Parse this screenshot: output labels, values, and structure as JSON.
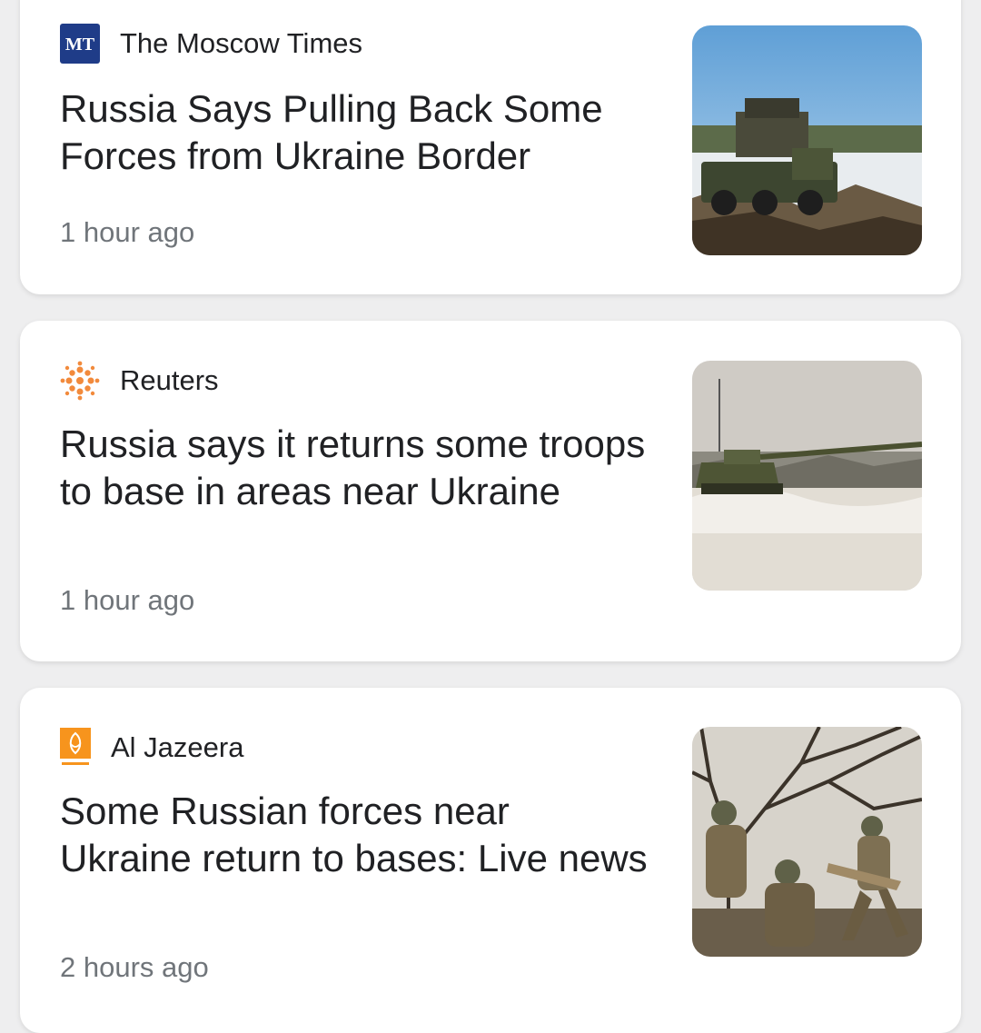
{
  "articles": [
    {
      "source": "The Moscow Times",
      "logo_text": "MT",
      "logo_icon": "moscow-times-logo",
      "headline": "Russia Says Pulling Back Some Forces from Ukraine Border",
      "time": "1 hour ago",
      "thumbnail": "military-vehicles-snow"
    },
    {
      "source": "Reuters",
      "logo_icon": "reuters-logo",
      "headline": "Russia says it returns some troops to base in areas near Ukraine",
      "time": "1 hour ago",
      "thumbnail": "tank-in-snow"
    },
    {
      "source": "Al Jazeera",
      "logo_icon": "al-jazeera-logo",
      "headline": "Some Russian forces near Ukraine return to bases: Live news",
      "time": "2 hours ago",
      "thumbnail": "soldiers-in-forest"
    }
  ],
  "colors": {
    "moscow_times_logo": "#1f3c88",
    "reuters_logo": "#f28a3c",
    "al_jazeera_logo": "#f7941d",
    "headline_text": "#202124",
    "meta_text": "#70757a"
  }
}
